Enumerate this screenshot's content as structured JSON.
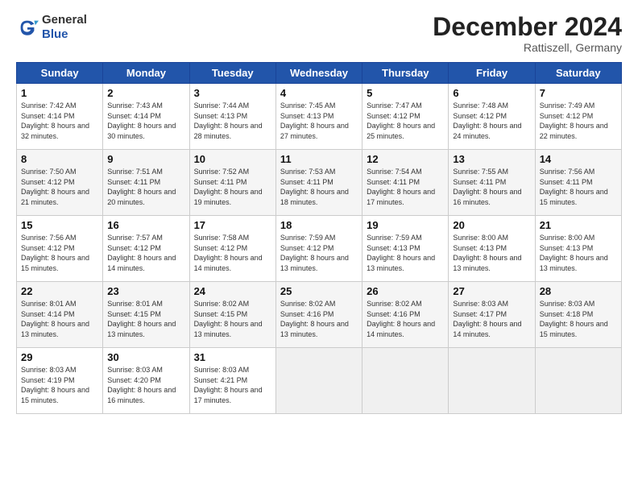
{
  "header": {
    "logo_general": "General",
    "logo_blue": "Blue",
    "month_year": "December 2024",
    "location": "Rattiszell, Germany"
  },
  "days_of_week": [
    "Sunday",
    "Monday",
    "Tuesday",
    "Wednesday",
    "Thursday",
    "Friday",
    "Saturday"
  ],
  "weeks": [
    [
      {
        "day": "1",
        "sunrise": "Sunrise: 7:42 AM",
        "sunset": "Sunset: 4:14 PM",
        "daylight": "Daylight: 8 hours and 32 minutes."
      },
      {
        "day": "2",
        "sunrise": "Sunrise: 7:43 AM",
        "sunset": "Sunset: 4:14 PM",
        "daylight": "Daylight: 8 hours and 30 minutes."
      },
      {
        "day": "3",
        "sunrise": "Sunrise: 7:44 AM",
        "sunset": "Sunset: 4:13 PM",
        "daylight": "Daylight: 8 hours and 28 minutes."
      },
      {
        "day": "4",
        "sunrise": "Sunrise: 7:45 AM",
        "sunset": "Sunset: 4:13 PM",
        "daylight": "Daylight: 8 hours and 27 minutes."
      },
      {
        "day": "5",
        "sunrise": "Sunrise: 7:47 AM",
        "sunset": "Sunset: 4:12 PM",
        "daylight": "Daylight: 8 hours and 25 minutes."
      },
      {
        "day": "6",
        "sunrise": "Sunrise: 7:48 AM",
        "sunset": "Sunset: 4:12 PM",
        "daylight": "Daylight: 8 hours and 24 minutes."
      },
      {
        "day": "7",
        "sunrise": "Sunrise: 7:49 AM",
        "sunset": "Sunset: 4:12 PM",
        "daylight": "Daylight: 8 hours and 22 minutes."
      }
    ],
    [
      {
        "day": "8",
        "sunrise": "Sunrise: 7:50 AM",
        "sunset": "Sunset: 4:12 PM",
        "daylight": "Daylight: 8 hours and 21 minutes."
      },
      {
        "day": "9",
        "sunrise": "Sunrise: 7:51 AM",
        "sunset": "Sunset: 4:11 PM",
        "daylight": "Daylight: 8 hours and 20 minutes."
      },
      {
        "day": "10",
        "sunrise": "Sunrise: 7:52 AM",
        "sunset": "Sunset: 4:11 PM",
        "daylight": "Daylight: 8 hours and 19 minutes."
      },
      {
        "day": "11",
        "sunrise": "Sunrise: 7:53 AM",
        "sunset": "Sunset: 4:11 PM",
        "daylight": "Daylight: 8 hours and 18 minutes."
      },
      {
        "day": "12",
        "sunrise": "Sunrise: 7:54 AM",
        "sunset": "Sunset: 4:11 PM",
        "daylight": "Daylight: 8 hours and 17 minutes."
      },
      {
        "day": "13",
        "sunrise": "Sunrise: 7:55 AM",
        "sunset": "Sunset: 4:11 PM",
        "daylight": "Daylight: 8 hours and 16 minutes."
      },
      {
        "day": "14",
        "sunrise": "Sunrise: 7:56 AM",
        "sunset": "Sunset: 4:11 PM",
        "daylight": "Daylight: 8 hours and 15 minutes."
      }
    ],
    [
      {
        "day": "15",
        "sunrise": "Sunrise: 7:56 AM",
        "sunset": "Sunset: 4:12 PM",
        "daylight": "Daylight: 8 hours and 15 minutes."
      },
      {
        "day": "16",
        "sunrise": "Sunrise: 7:57 AM",
        "sunset": "Sunset: 4:12 PM",
        "daylight": "Daylight: 8 hours and 14 minutes."
      },
      {
        "day": "17",
        "sunrise": "Sunrise: 7:58 AM",
        "sunset": "Sunset: 4:12 PM",
        "daylight": "Daylight: 8 hours and 14 minutes."
      },
      {
        "day": "18",
        "sunrise": "Sunrise: 7:59 AM",
        "sunset": "Sunset: 4:12 PM",
        "daylight": "Daylight: 8 hours and 13 minutes."
      },
      {
        "day": "19",
        "sunrise": "Sunrise: 7:59 AM",
        "sunset": "Sunset: 4:13 PM",
        "daylight": "Daylight: 8 hours and 13 minutes."
      },
      {
        "day": "20",
        "sunrise": "Sunrise: 8:00 AM",
        "sunset": "Sunset: 4:13 PM",
        "daylight": "Daylight: 8 hours and 13 minutes."
      },
      {
        "day": "21",
        "sunrise": "Sunrise: 8:00 AM",
        "sunset": "Sunset: 4:13 PM",
        "daylight": "Daylight: 8 hours and 13 minutes."
      }
    ],
    [
      {
        "day": "22",
        "sunrise": "Sunrise: 8:01 AM",
        "sunset": "Sunset: 4:14 PM",
        "daylight": "Daylight: 8 hours and 13 minutes."
      },
      {
        "day": "23",
        "sunrise": "Sunrise: 8:01 AM",
        "sunset": "Sunset: 4:15 PM",
        "daylight": "Daylight: 8 hours and 13 minutes."
      },
      {
        "day": "24",
        "sunrise": "Sunrise: 8:02 AM",
        "sunset": "Sunset: 4:15 PM",
        "daylight": "Daylight: 8 hours and 13 minutes."
      },
      {
        "day": "25",
        "sunrise": "Sunrise: 8:02 AM",
        "sunset": "Sunset: 4:16 PM",
        "daylight": "Daylight: 8 hours and 13 minutes."
      },
      {
        "day": "26",
        "sunrise": "Sunrise: 8:02 AM",
        "sunset": "Sunset: 4:16 PM",
        "daylight": "Daylight: 8 hours and 14 minutes."
      },
      {
        "day": "27",
        "sunrise": "Sunrise: 8:03 AM",
        "sunset": "Sunset: 4:17 PM",
        "daylight": "Daylight: 8 hours and 14 minutes."
      },
      {
        "day": "28",
        "sunrise": "Sunrise: 8:03 AM",
        "sunset": "Sunset: 4:18 PM",
        "daylight": "Daylight: 8 hours and 15 minutes."
      }
    ],
    [
      {
        "day": "29",
        "sunrise": "Sunrise: 8:03 AM",
        "sunset": "Sunset: 4:19 PM",
        "daylight": "Daylight: 8 hours and 15 minutes."
      },
      {
        "day": "30",
        "sunrise": "Sunrise: 8:03 AM",
        "sunset": "Sunset: 4:20 PM",
        "daylight": "Daylight: 8 hours and 16 minutes."
      },
      {
        "day": "31",
        "sunrise": "Sunrise: 8:03 AM",
        "sunset": "Sunset: 4:21 PM",
        "daylight": "Daylight: 8 hours and 17 minutes."
      },
      null,
      null,
      null,
      null
    ]
  ]
}
